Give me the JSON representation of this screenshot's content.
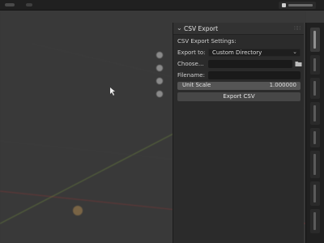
{
  "panel": {
    "title": "CSV Export",
    "collapse_icon": "chevron-down-icon",
    "grip_icon": "drag-grip-icon",
    "settings_heading": "CSV Export Settings:",
    "export_to_label": "Export to:",
    "export_to_value": "Custom Directory",
    "choose_label": "Choose...",
    "choose_value": "",
    "folder_icon": "folder-icon",
    "filename_label": "Filename:",
    "filename_value": "",
    "unit_scale_label": "Unit Scale",
    "unit_scale_value": "1.000000",
    "export_button": "Export CSV"
  },
  "viewport": {
    "background": "#393939",
    "x_axis_color": "#8a3a3a",
    "y_axis_color": "#6f8a3c"
  },
  "sidebar": {
    "tabs": [
      "tab-1",
      "tab-2",
      "tab-3",
      "tab-4",
      "tab-5",
      "tab-6",
      "tab-7",
      "tab-8"
    ]
  }
}
